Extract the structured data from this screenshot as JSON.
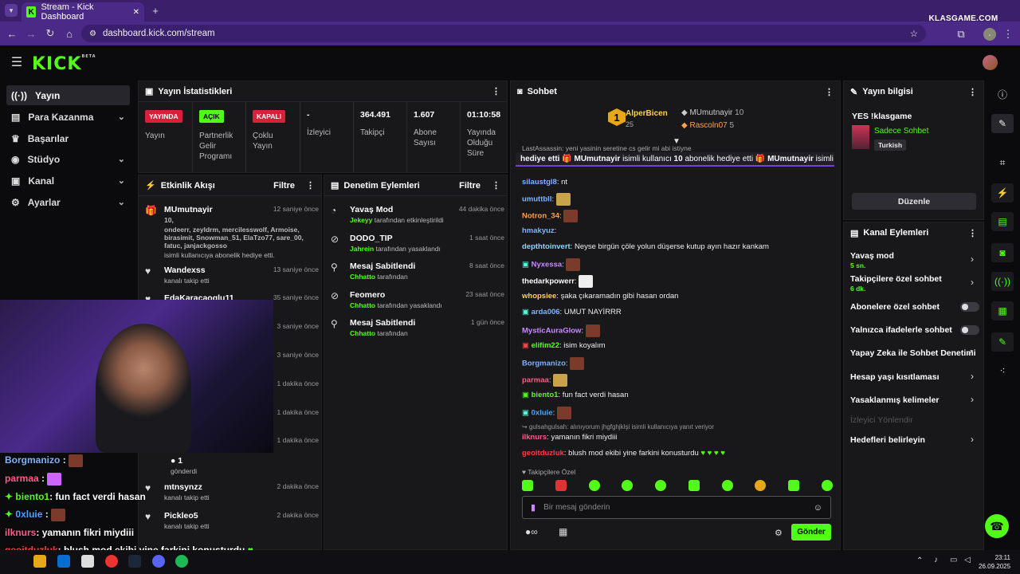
{
  "browser": {
    "tab_title": "Stream - Kick Dashboard",
    "url": "dashboard.kick.com/stream",
    "watermark": "KLASGAME.COM"
  },
  "kick": {
    "logo": "KICK",
    "logo_sup": "BETA"
  },
  "sidebar": {
    "items": [
      {
        "label": "Yayın",
        "icon": "broadcast-icon"
      },
      {
        "label": "Para Kazanma",
        "icon": "money-icon"
      },
      {
        "label": "Başarılar",
        "icon": "trophy-icon"
      },
      {
        "label": "Stüdyo",
        "icon": "studio-icon"
      },
      {
        "label": "Kanal",
        "icon": "channel-icon"
      },
      {
        "label": "Ayarlar",
        "icon": "gear-icon"
      }
    ]
  },
  "stats": {
    "title": "Yayın İstatistikleri",
    "status_badge": "YAYINDA",
    "status_label": "Yayın",
    "partner_badge": "AÇIK",
    "partner_label": "Partnerlik Gelir Programı",
    "multi_badge": "KAPALI",
    "multi_label": "Çoklu Yayın",
    "viewers_val": "-",
    "viewers_label": "İzleyici",
    "followers_val": "364.491",
    "followers_label": "Takipçi",
    "subs_val": "1.607",
    "subs_label": "Abone Sayısı",
    "uptime_val": "01:10:58",
    "uptime_label": "Yayında Olduğu Süre"
  },
  "activity": {
    "title": "Etkinlik Akışı",
    "filter": "Filtre",
    "first": {
      "user": "MUmutnayir",
      "time": "12 saniye önce",
      "count": "10,",
      "names": "ondeerr, zeyldrm, mercilesswolf, Armoise, birasimit, Snowman_51, ElaTzo77, sare_00, fatuc, janjackgosso",
      "desc": "isimli kullanıcıya abonelik hediye etti."
    },
    "second": {
      "user": "Wandexss",
      "time": "13 saniye önce",
      "desc": "kanalı takip etti"
    },
    "third": {
      "user": "EdaKaracaoglu11",
      "time": "35 saniye önce"
    },
    "times": [
      "3 saniye önce",
      "3 saniye önce",
      "1 dakika önce",
      "1 dakika önce",
      "1 dakika önce"
    ],
    "gift_count": "1",
    "gift_desc": "gönderdi",
    "rows": [
      {
        "user": "mtnsynzz",
        "time": "2 dakika önce",
        "desc": "kanalı takip etti"
      },
      {
        "user": "Pickleo5",
        "time": "2 dakika önce",
        "desc": "kanalı takip etti"
      }
    ]
  },
  "moderation": {
    "title": "Denetim Eylemleri",
    "filter": "Filtre",
    "rows": [
      {
        "title": "Yavaş Mod",
        "user": "Jekeyy",
        "desc": "tarafından etkinleştirildi",
        "time": "44 dakika önce",
        "icon": "slow-icon"
      },
      {
        "title": "DODO_TIP",
        "user": "Jahrein",
        "desc": "tarafından yasaklandı",
        "time": "1 saat önce",
        "icon": "ban-icon"
      },
      {
        "title": "Mesaj Sabitlendi",
        "user": "Chhatto",
        "desc": "tarafından",
        "time": "8 saat önce",
        "icon": "pin-icon"
      },
      {
        "title": "Feomero",
        "user": "Chhatto",
        "desc": "tarafından yasaklandı",
        "time": "23 saat önce",
        "icon": "ban-icon"
      },
      {
        "title": "Mesaj Sabitlendi",
        "user": "Chhatto",
        "desc": "tarafından",
        "time": "1 gün önce",
        "icon": "pin-icon"
      }
    ]
  },
  "chat": {
    "title": "Sohbet",
    "leaders": {
      "first": "AlperBicen",
      "first_count": "25",
      "second": "MUmutnayir",
      "second_count": "10",
      "third": "Rascoln07",
      "third_count": "5",
      "rank": "1"
    },
    "top_line": "LastAssassin: yeni yasinin seretine cs gelir mi abi istiyne",
    "banner_prefix": "hediye etti",
    "banner_user": "MUmutnayir",
    "banner_text": "isimli kullanıcı",
    "banner_count": "10",
    "banner_suffix": "abonelik hediye etti",
    "banner_user2": "MUmutnayir",
    "banner_text2": "isimli k",
    "messages": [
      {
        "user": "silaustgl8",
        "color": "#7fb2ff",
        "text": "nt"
      },
      {
        "user": "umuttbll",
        "color": "#7fb2ff",
        "text": "",
        "emote": true
      },
      {
        "user": "Notron_34",
        "color": "#ffa04a",
        "text": "",
        "emote": true
      },
      {
        "user": "hmakyuz",
        "color": "#7fb2ff",
        "text": ""
      },
      {
        "user": "depthtoinvert",
        "color": "#7fdcff",
        "text": "Neyse birgün çöle yolun düşerse kutup ayın hazır kankam"
      },
      {
        "user": "Nyxessa",
        "color": "#c98bff",
        "text": "",
        "emote": true
      },
      {
        "user": "thedarkpowerr",
        "color": "#ffffff",
        "text": "",
        "emote": true
      },
      {
        "user": "whopsiee",
        "color": "#ffd24a",
        "text": "şaka çıkaramadın gibi hasan ordan"
      },
      {
        "user": "arda006",
        "color": "#7fb2ff",
        "text": "UMUT NAYİRRR"
      },
      {
        "user": "MysticAuraGlow",
        "color": "#c98bff",
        "text": "",
        "emote": true
      },
      {
        "user": "elifim22",
        "color": "#53fc18",
        "text": "isim koyalım"
      },
      {
        "user": "Borgmanizo",
        "color": "#7fb2ff",
        "text": "",
        "emote": true
      },
      {
        "user": "parmaa",
        "color": "#ff5c8a",
        "text": "",
        "emote": true
      },
      {
        "user": "biento1",
        "color": "#53fc18",
        "text": "fun fact verdi hasan"
      },
      {
        "user": "0xluie",
        "color": "#4aa3ff",
        "text": "",
        "emote": true
      }
    ],
    "reply_hint": "gulsahgulsah: alınıyorum jhgfghjklşi isimli kullanıcıya yanıt veriyor",
    "reply_user": "ilknurs",
    "reply_text": "yamanın fikri miydiii",
    "last_user": "geoitduzluk",
    "last_text": "blush mod ekibi yine farkini konusturdu",
    "followers_only": "Takipçilere Özel",
    "input_placeholder": "Bir mesaj gönderin",
    "send": "Gönder"
  },
  "stream_info": {
    "title": "Yayın bilgisi",
    "stream_title": "YES !klasgame",
    "category": "Sadece Sohbet",
    "tag": "Turkish",
    "edit": "Düzenle"
  },
  "channel_actions": {
    "title": "Kanal Eylemleri",
    "slow": "Yavaş mod",
    "slow_sub": "5 sn.",
    "followers": "Takipçilere özel sohbet",
    "followers_sub": "6 dk.",
    "subs": "Abonelere özel sohbet",
    "emotes": "Yalnızca ifadelerle sohbet",
    "ai": "Yapay Zeka ile Sohbet Denetimi",
    "age": "Hesap yaşı kısıtlaması",
    "banned": "Yasaklanmış kelimeler",
    "redirect": "İzleyici Yönlendir",
    "goals": "Hedefleri belirleyin"
  },
  "overlay": {
    "lines": [
      {
        "user": "Borgmanizo",
        "text": ":"
      },
      {
        "user": "parmaa",
        "text": ":"
      },
      {
        "user": "biento1",
        "text": ": fun fact verdi hasan"
      },
      {
        "user": "0xluie",
        "text": ":"
      },
      {
        "user": "ilknurs",
        "text": ": yamanın fikri miydiii"
      },
      {
        "user": "geoitduzluk",
        "text": ": blush mod ekibi yine farkini konusturdu"
      }
    ]
  },
  "taskbar": {
    "time": "23:11",
    "date": "26.09.2025"
  }
}
